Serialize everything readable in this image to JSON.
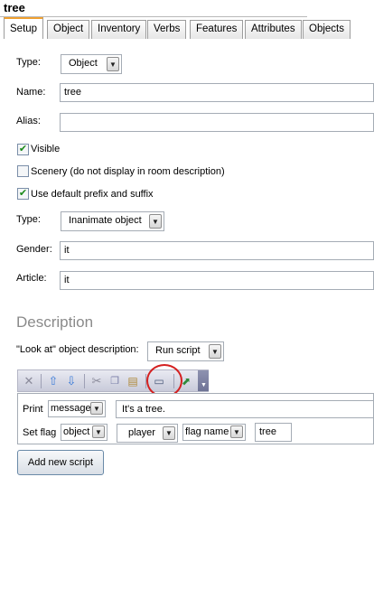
{
  "window": {
    "title": "tree"
  },
  "tabs": [
    {
      "label": "Setup",
      "active": true
    },
    {
      "label": "Object"
    },
    {
      "label": "Inventory"
    },
    {
      "label": "Verbs"
    },
    {
      "label": "Features"
    },
    {
      "label": "Attributes"
    },
    {
      "label": "Objects"
    }
  ],
  "setup": {
    "type_label": "Type:",
    "type_value": "Object",
    "name_label": "Name:",
    "name_value": "tree",
    "alias_label": "Alias:",
    "alias_value": "",
    "visible_label": "Visible",
    "visible_checked": true,
    "scenery_label": "Scenery (do not display in room description)",
    "scenery_checked": false,
    "prefix_label": "Use default prefix and suffix",
    "prefix_checked": true,
    "type2_label": "Type:",
    "type2_value": "Inanimate object",
    "gender_label": "Gender:",
    "gender_value": "it",
    "article_label": "Article:",
    "article_value": "it"
  },
  "description": {
    "heading": "Description",
    "look_label": "\"Look at\" object description:",
    "look_value": "Run script",
    "toolbar": [
      "delete-icon",
      "move-up-icon",
      "move-down-icon",
      "cut-icon",
      "copy-icon",
      "paste-icon",
      "code-view-icon",
      "popout-icon"
    ],
    "script": {
      "print": {
        "command": "Print",
        "mode": "message",
        "text": "It's a tree."
      },
      "setflag": {
        "command": "Set flag",
        "target_type": "object",
        "object": "player",
        "flag_type": "flag name",
        "flag_value": "tree"
      }
    },
    "add_button": "Add new script"
  }
}
